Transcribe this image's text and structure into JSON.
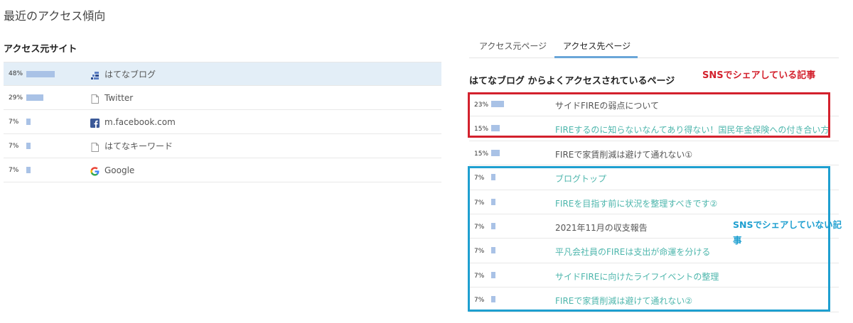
{
  "page": {
    "title": "最近のアクセス傾向"
  },
  "sources": {
    "header": "アクセス元サイト",
    "rows": [
      {
        "percent": "48%",
        "value": 48,
        "icon": "hatena-blog-icon",
        "label": "はてなブログ"
      },
      {
        "percent": "29%",
        "value": 29,
        "icon": "page-icon",
        "label": "Twitter"
      },
      {
        "percent": "7%",
        "value": 7,
        "icon": "facebook-icon",
        "label": "m.facebook.com"
      },
      {
        "percent": "7%",
        "value": 7,
        "icon": "page-icon",
        "label": "はてなキーワード"
      },
      {
        "percent": "7%",
        "value": 7,
        "icon": "google-icon",
        "label": "Google"
      }
    ]
  },
  "tabs": [
    {
      "label": "アクセス元ページ",
      "active": false
    },
    {
      "label": "アクセス先ページ",
      "active": true
    }
  ],
  "destinations": {
    "header": "はてなブログ からよくアクセスされているページ",
    "rows": [
      {
        "percent": "23%",
        "value": 23,
        "label": "サイドFIREの弱点について",
        "visited": true
      },
      {
        "percent": "15%",
        "value": 15,
        "label": "FIREするのに知らないなんてあり得ない！国民年金保険への付き合い方",
        "visited": false
      },
      {
        "percent": "15%",
        "value": 15,
        "label": "FIREで家賃削減は避けて通れない①",
        "visited": true
      },
      {
        "percent": "7%",
        "value": 7,
        "label": "ブログトップ",
        "visited": false
      },
      {
        "percent": "7%",
        "value": 7,
        "label": "FIREを目指す前に状況を整理すべきです②",
        "visited": false
      },
      {
        "percent": "7%",
        "value": 7,
        "label": "2021年11月の収支報告",
        "visited": true
      },
      {
        "percent": "7%",
        "value": 7,
        "label": "平凡会社員のFIREは支出が命運を分ける",
        "visited": false
      },
      {
        "percent": "7%",
        "value": 7,
        "label": "サイドFIREに向けたライフイベントの整理",
        "visited": false
      },
      {
        "percent": "7%",
        "value": 7,
        "label": "FIREで家賃削減は避けて通れない②",
        "visited": false
      }
    ]
  },
  "annotations": {
    "shared": "SNSでシェアしている記事",
    "not_shared": "SNSでシェアしていない記事"
  },
  "colors": {
    "bar": "#a9c2e6",
    "active_row": "#e3eef7",
    "red": "#d3212d",
    "blue": "#1e9fd0",
    "link": "#4db6ac"
  }
}
